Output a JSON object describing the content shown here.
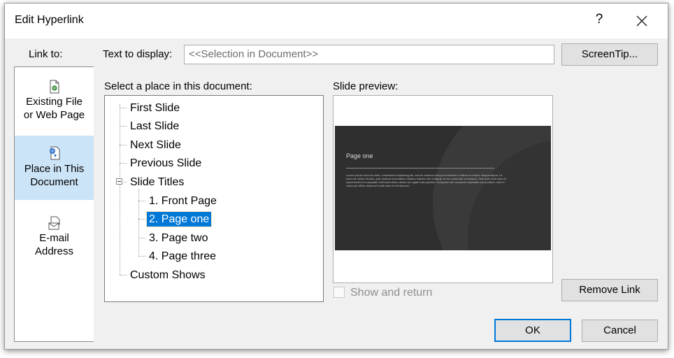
{
  "dialog": {
    "title": "Edit Hyperlink",
    "help_label": "?",
    "colors": {
      "accent": "#0078d7",
      "selected_nav": "#cce4f7",
      "face": "#f0f0f0"
    }
  },
  "link_to": {
    "label": "Link to:",
    "items": [
      {
        "label_line1": "Existing File",
        "label_line2": "or Web Page",
        "icon": "existing-file-icon",
        "selected": false
      },
      {
        "label_line1": "Place in This",
        "label_line2": "Document",
        "icon": "place-in-document-icon",
        "selected": true
      },
      {
        "label_line1": "E-mail",
        "label_line2": "Address",
        "icon": "email-address-icon",
        "selected": false
      }
    ]
  },
  "text_to_display": {
    "label": "Text to display:",
    "value": "<<Selection in Document>>"
  },
  "screentip_label": "ScreenTip...",
  "place": {
    "label": "Select a place in this document:",
    "tree": [
      {
        "label": "First Slide"
      },
      {
        "label": "Last Slide"
      },
      {
        "label": "Next Slide"
      },
      {
        "label": "Previous Slide"
      },
      {
        "label": "Slide Titles",
        "expanded": true
      },
      {
        "label": "1. Front Page"
      },
      {
        "label": "2. Page one",
        "selected": true
      },
      {
        "label": "3. Page two"
      },
      {
        "label": "4. Page three"
      },
      {
        "label": "Custom Shows"
      }
    ]
  },
  "preview": {
    "label": "Slide preview:",
    "slide_title": "Page one",
    "slide_body": "Lorem ipsum dolor sit amet, consectetur adipiscing elit, sed do eiusmod tempor incididunt ut labore et dolore magna aliqua. Ut enim ad minim veniam, quis nostrud exercitation ullamco laboris nisi ut aliquip ex ea commodo consequat. Duis aute irure dolor in reprehenderit in voluptate velit esse cillum dolore eu fugiat nulla pariatur. Excepteur sint occaecat cupidatat non proident, sunt in culpa qui officia deserunt mollit anim id est laborum."
  },
  "show_and_return": {
    "label": "Show and return",
    "checked": false,
    "enabled": false
  },
  "buttons": {
    "remove_link": "Remove Link",
    "ok": "OK",
    "cancel": "Cancel"
  }
}
